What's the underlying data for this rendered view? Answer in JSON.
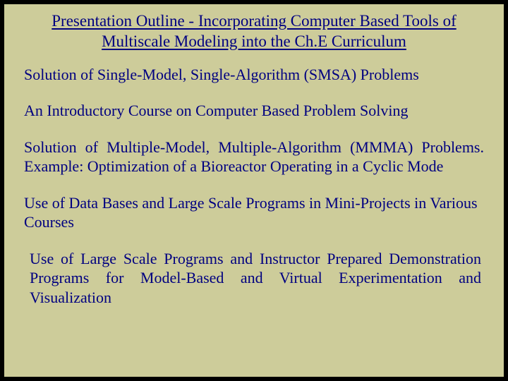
{
  "slide": {
    "title": "Presentation Outline - Incorporating Computer Based Tools of Multiscale Modeling into the Ch.E Curriculum",
    "items": [
      "Solution of Single-Model, Single-Algorithm (SMSA) Problems",
      "An Introductory Course on Computer Based Problem Solving",
      "Solution of Multiple-Model, Multiple-Algorithm (MMMA) Problems. Example: Optimization of a Bioreactor Operating in a Cyclic Mode",
      "Use of Data Bases and Large Scale Programs in Mini-Projects in Various Courses",
      "Use of Large Scale Programs and Instructor Prepared Demonstration Programs for Model-Based and Virtual Experimentation and Visualization"
    ]
  }
}
